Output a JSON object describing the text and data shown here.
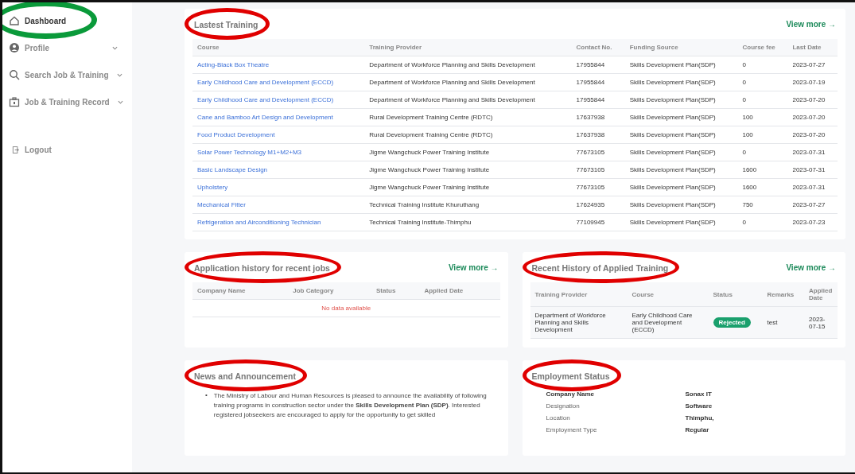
{
  "sidebar": {
    "items": [
      {
        "label": "Dashboard",
        "kind": "home",
        "selected": true,
        "expandable": false,
        "circled": true
      },
      {
        "label": "Profile",
        "kind": "user",
        "selected": false,
        "expandable": true,
        "circled": false
      },
      {
        "label": "Search Job & Training",
        "kind": "search",
        "selected": false,
        "expandable": true,
        "circled": false
      },
      {
        "label": "Job & Training Record",
        "kind": "record",
        "selected": false,
        "expandable": true,
        "circled": false
      },
      {
        "label": "Logout",
        "kind": "logout",
        "selected": false,
        "expandable": false,
        "circled": false
      }
    ]
  },
  "latest_training": {
    "title": "Lastest Training",
    "circled": true,
    "view_more": "View more →",
    "columns": [
      "Course",
      "Training Provider",
      "Contact No.",
      "Funding Source",
      "Course fee",
      "Last Date"
    ],
    "rows": [
      [
        "Acting-Black Box Theatre",
        "Department of Workforce Planning and Skills Development",
        "17955844",
        "Skills Development Plan(SDP)",
        "0",
        "2023-07-27"
      ],
      [
        "Early Childhood Care and Development (ECCD)",
        "Department of Workforce Planning and Skills Development",
        "17955844",
        "Skills Development Plan(SDP)",
        "0",
        "2023-07-19"
      ],
      [
        "Early Childhood Care and Development (ECCD)",
        "Department of Workforce Planning and Skills Development",
        "17955844",
        "Skills Development Plan(SDP)",
        "0",
        "2023-07-20"
      ],
      [
        "Cane and Bamboo Art Design and Development",
        "Rural Development Training Centre (RDTC)",
        "17637938",
        "Skills Development Plan(SDP)",
        "100",
        "2023-07-20"
      ],
      [
        "Food Product Development",
        "Rural Development Training Centre (RDTC)",
        "17637938",
        "Skills Development Plan(SDP)",
        "100",
        "2023-07-20"
      ],
      [
        "Solar Power Technology M1+M2+M3",
        "Jigme Wangchuck Power Training Institute",
        "77673105",
        "Skills Development Plan(SDP)",
        "0",
        "2023-07-31"
      ],
      [
        "Basic Landscape Design",
        "Jigme Wangchuck Power Training Institute",
        "77673105",
        "Skills Development Plan(SDP)",
        "1600",
        "2023-07-31"
      ],
      [
        "Upholstery",
        "Jigme Wangchuck Power Training Institute",
        "77673105",
        "Skills Development Plan(SDP)",
        "1600",
        "2023-07-31"
      ],
      [
        "Mechanical Fitter",
        "Technical Training Institute Khuruthang",
        "17624935",
        "Skills Development Plan(SDP)",
        "750",
        "2023-07-27"
      ],
      [
        "Refrigeration and Airconditioning Technician",
        "Technical Training Institute-Thimphu",
        "77109945",
        "Skills Development Plan(SDP)",
        "0",
        "2023-07-23"
      ]
    ]
  },
  "job_history": {
    "title": "Application history for recent jobs",
    "circled": true,
    "view_more": "View more →",
    "columns": [
      "Company Name",
      "Job Category",
      "Status",
      "Applied Date"
    ],
    "empty_message": "No data available"
  },
  "training_history": {
    "title": "Recent History of Applied Training",
    "circled": true,
    "view_more": "View more →",
    "columns": [
      "Training Provider",
      "Course",
      "Status",
      "Remarks",
      "Applied Date"
    ],
    "rows": [
      {
        "provider": "Department of Workforce Planning and Skills Development",
        "course": "Early Childhood Care and Development (ECCD)",
        "status": "Rejected",
        "remarks": "test",
        "applied_date": "2023-07-15"
      }
    ]
  },
  "news": {
    "title": "News and Announcement",
    "circled": true,
    "items": [
      {
        "bullet": "•",
        "text": "The Ministry of Labour and Human Resources is pleased to announce the availability of following training programs in construction sector under the **Skills Development Plan (SDP)**. Interested registered jobseekers are encouraged to apply for the opportunity to get skilled"
      }
    ]
  },
  "employment": {
    "title": "Employment Status",
    "circled": true,
    "fields": [
      {
        "label": "Company Name",
        "value": "Sonax IT",
        "bold_label": true
      },
      {
        "label": "Designation",
        "value": "Software",
        "bold_label": false
      },
      {
        "label": "Location",
        "value": "Thimphu,",
        "bold_label": false
      },
      {
        "label": "Employment Type",
        "value": "Regular",
        "bold_label": false
      }
    ]
  }
}
